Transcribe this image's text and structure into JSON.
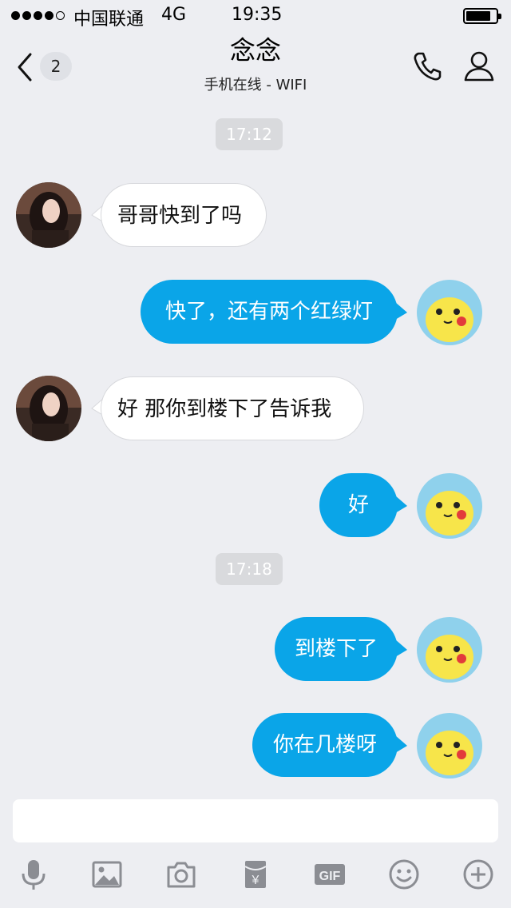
{
  "status_bar": {
    "carrier": "中国联通",
    "network": "4G",
    "time": "19:35",
    "signal_bars": 4,
    "signal_max": 5
  },
  "header": {
    "back_icon": "chevron-left-icon",
    "unread_count": "2",
    "title": "念念",
    "subtitle": "手机在线 - WIFI",
    "call_icon": "phone-icon",
    "profile_icon": "person-icon"
  },
  "messages": [
    {
      "type": "time",
      "text": "17:12"
    },
    {
      "type": "in",
      "text": "哥哥快到了吗"
    },
    {
      "type": "out",
      "text": "快了，还有两个红绿灯"
    },
    {
      "type": "in",
      "text": "好 那你到楼下了告诉我"
    },
    {
      "type": "out",
      "text": "好"
    },
    {
      "type": "time",
      "text": "17:18"
    },
    {
      "type": "out",
      "text": "到楼下了"
    },
    {
      "type": "out",
      "text": "你在几楼呀"
    }
  ],
  "toolbar": {
    "items": [
      "microphone-icon",
      "image-icon",
      "camera-icon",
      "red-packet-icon",
      "gif-icon",
      "emoji-icon",
      "plus-icon"
    ],
    "gif_label": "GIF",
    "red_packet_symbol": "¥"
  },
  "colors": {
    "background": "#edeef2",
    "outgoing_bubble": "#0aa5e8",
    "incoming_bubble": "#ffffff",
    "icon_gray": "#8b8d93"
  }
}
